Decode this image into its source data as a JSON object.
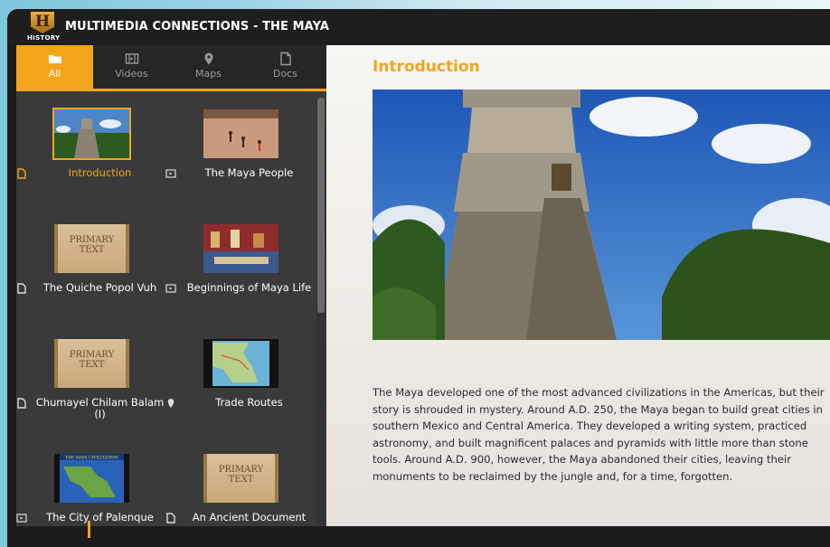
{
  "app": {
    "title": "MULTIMEDIA CONNECTIONS - THE MAYA",
    "logo_letter": "H",
    "logo_word": "HISTORY"
  },
  "tabs": [
    {
      "label": "All",
      "icon": "folder-icon",
      "active": true
    },
    {
      "label": "Videos",
      "icon": "film-icon",
      "active": false
    },
    {
      "label": "Maps",
      "icon": "map-pin-icon",
      "active": false
    },
    {
      "label": "Docs",
      "icon": "document-icon",
      "active": false
    }
  ],
  "items": [
    {
      "label": "Introduction",
      "type": "document-icon",
      "selected": true
    },
    {
      "label": "The Maya People",
      "type": "film-icon",
      "selected": false
    },
    {
      "label": "The Quiche Popol Vuh",
      "type": "document-icon",
      "selected": false
    },
    {
      "label": "Beginnings of Maya Life",
      "type": "film-icon",
      "selected": false
    },
    {
      "label": "Chumayel Chilam Balam (I)",
      "type": "document-icon",
      "selected": false
    },
    {
      "label": "Trade Routes",
      "type": "map-pin-icon",
      "selected": false
    },
    {
      "label": "The City of Palenque",
      "type": "film-icon",
      "selected": false
    },
    {
      "label": "An Ancient Document",
      "type": "document-icon",
      "selected": false
    }
  ],
  "thumb_text": {
    "primary": "PRIMARY",
    "text": "TEXT",
    "map_caption": "THE MAYA CIVILIZATION"
  },
  "content": {
    "heading": "Introduction",
    "body": "The Maya developed one of the most advanced civilizations in the Americas, but their story is shrouded in mystery. Around A.D. 250, the Maya began to build great cities in southern Mexico and Central America. They developed a writing system, practiced astronomy, and built magnificent palaces and pyramids with little more than stone tools. Around A.D. 900, however, the Maya abandoned their cities, leaving their monuments to be reclaimed by the jungle and, for a time, forgotten."
  },
  "colors": {
    "accent": "#f3a51b",
    "panel": "#3a3a3a",
    "titlebar": "#1e1e1e"
  }
}
